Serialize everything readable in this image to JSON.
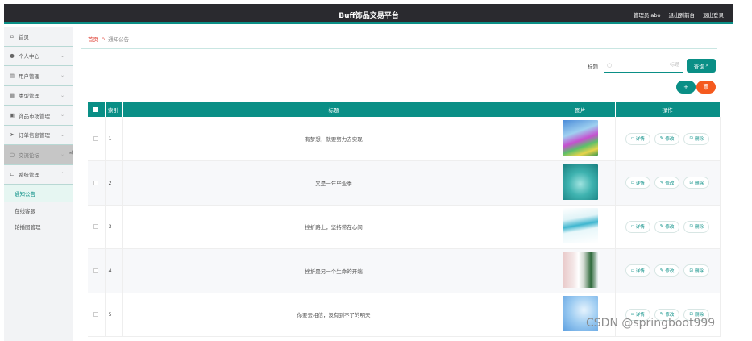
{
  "header": {
    "title": "Buff饰品交易平台",
    "admin": "管理员 abo",
    "back_to_front": "退出到前台",
    "logout": "退出登录"
  },
  "sidebar": {
    "items": [
      {
        "label": "首页",
        "icon": "home-icon",
        "glyph": "⌂"
      },
      {
        "label": "个人中心",
        "icon": "user-icon",
        "glyph": "👤"
      },
      {
        "label": "用户管理",
        "icon": "users-icon",
        "glyph": "▤"
      },
      {
        "label": "类型管理",
        "icon": "grid-icon",
        "glyph": "▦"
      },
      {
        "label": "饰品市场管理",
        "icon": "market-icon",
        "glyph": "▣"
      },
      {
        "label": "订单信息管理",
        "icon": "send-icon",
        "glyph": "➤"
      },
      {
        "label": "交流论坛",
        "icon": "forum-icon",
        "glyph": "▢"
      },
      {
        "label": "系统管理",
        "icon": "system-icon",
        "glyph": "⊏"
      }
    ],
    "sub_items": [
      {
        "label": "通知公告"
      },
      {
        "label": "在线客服"
      },
      {
        "label": "轮播图管理"
      }
    ]
  },
  "breadcrumb": {
    "home": "首页",
    "current": "通知公告"
  },
  "search": {
    "label": "标题",
    "placeholder": "标题",
    "button": "查询"
  },
  "actions": {
    "add": "+",
    "delete": "🗑"
  },
  "table": {
    "headers": [
      "索引",
      "标题",
      "图片",
      "操作"
    ],
    "op_labels": {
      "detail": "详情",
      "edit": "修改",
      "delete": "删除"
    },
    "rows": [
      {
        "index": "1",
        "title": "有梦想，就要努力去实现"
      },
      {
        "index": "2",
        "title": "又是一年毕业季"
      },
      {
        "index": "3",
        "title": "挫折路上，坚持常在心间"
      },
      {
        "index": "4",
        "title": "挫折是另一个生命的开端"
      },
      {
        "index": "5",
        "title": "你要去相信，没有到不了的明天"
      }
    ]
  },
  "watermark": "CSDN @springboot999",
  "colors": {
    "accent": "#0a8f86",
    "danger": "#f55a1e",
    "topbar": "#2a2a2f"
  }
}
